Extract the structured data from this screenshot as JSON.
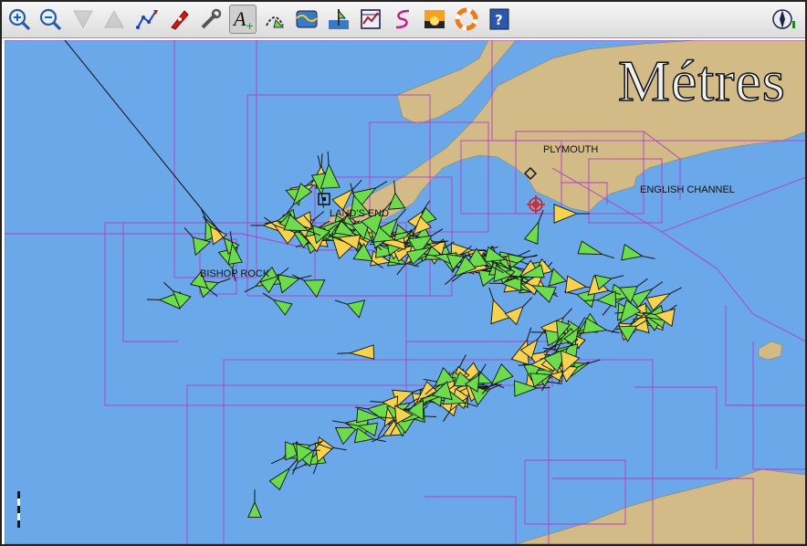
{
  "toolbar": {
    "buttons": [
      {
        "id": "zoom-in",
        "icon": "zoom-in-icon"
      },
      {
        "id": "zoom-out",
        "icon": "zoom-out-icon"
      },
      {
        "id": "scale-in",
        "icon": "scale-in-icon",
        "disabled": true
      },
      {
        "id": "scale-out",
        "icon": "scale-out-icon",
        "disabled": true
      },
      {
        "id": "route",
        "icon": "route-icon"
      },
      {
        "id": "follow",
        "icon": "boat-icon"
      },
      {
        "id": "settings",
        "icon": "wrench-icon"
      },
      {
        "id": "text",
        "icon": "text-icon",
        "pressed": true
      },
      {
        "id": "current",
        "icon": "current-icon"
      },
      {
        "id": "tide",
        "icon": "tide-icon"
      },
      {
        "id": "ais",
        "icon": "ais-icon"
      },
      {
        "id": "logbook",
        "icon": "chart-window-icon"
      },
      {
        "id": "track",
        "icon": "track-icon"
      },
      {
        "id": "color",
        "icon": "sunset-icon"
      },
      {
        "id": "mob",
        "icon": "lifebuoy-icon"
      },
      {
        "id": "help",
        "icon": "help-icon",
        "label": "?"
      },
      {
        "id": "compass",
        "icon": "compass-icon"
      }
    ]
  },
  "chart": {
    "units_label": "Métres",
    "places": [
      {
        "id": "plymouth",
        "label": "PLYMOUTH"
      },
      {
        "id": "lands-end",
        "label": "LAND'S END"
      },
      {
        "id": "english-channel",
        "label": "ENGLISH CHANNEL"
      },
      {
        "id": "bishop-rock",
        "label": "BISHOP ROCK"
      }
    ],
    "colors": {
      "sea": "#6aa8ea",
      "land": "#d2bb87",
      "chart_boundary": "#b43cc8",
      "ais_target_green": "#6ddc4c",
      "ais_target_yellow": "#f6d34c"
    }
  }
}
